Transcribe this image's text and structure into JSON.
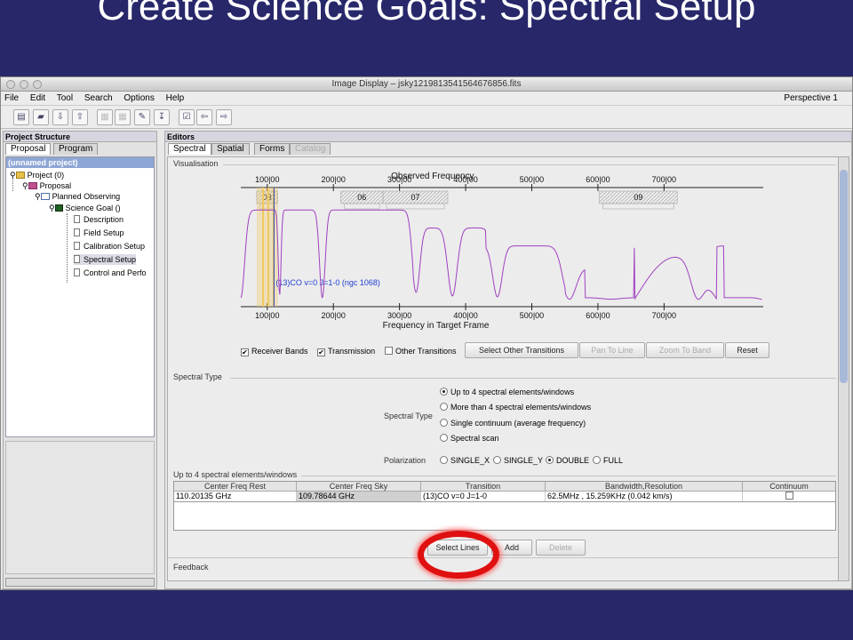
{
  "slide": {
    "title": "Create Science Goals: Spectral Setup"
  },
  "window": {
    "title": "Image Display – jsky1219813541564676856.fits",
    "menu": [
      "File",
      "Edit",
      "Tool",
      "Search",
      "Options",
      "Help"
    ],
    "perspective": "Perspective 1",
    "toolbar_icons": [
      "new-document-icon",
      "open-icon",
      "save-icon",
      "export-icon",
      "cut-icon",
      "copy-icon",
      "validate-icon",
      "import-icon",
      "checkbox-icon",
      "back-arrow-icon",
      "forward-arrow-icon"
    ]
  },
  "project_structure": {
    "header": "Project Structure",
    "tabs": [
      "Proposal",
      "Program"
    ],
    "selected_project": "(unnamed project)",
    "tree": [
      {
        "label": "Project (0)"
      },
      {
        "label": "Proposal"
      },
      {
        "label": "Planned Observing"
      },
      {
        "label": "Science Goal ()"
      },
      {
        "label": "Description"
      },
      {
        "label": "Field Setup"
      },
      {
        "label": "Calibration Setup"
      },
      {
        "label": "Spectral Setup"
      },
      {
        "label": "Control and Perfo"
      }
    ]
  },
  "editors": {
    "header": "Editors",
    "tabs": [
      "Spectral",
      "Spatial",
      "Forms",
      "Catalog"
    ],
    "visualisation": {
      "label": "Visualisation",
      "checks": [
        {
          "label": "Receiver Bands",
          "checked": true
        },
        {
          "label": "Transmission",
          "checked": true
        },
        {
          "label": "Other Transitions",
          "checked": false
        }
      ],
      "buttons": [
        {
          "label": "Select Other Transitions",
          "enabled": true
        },
        {
          "label": "Pan To Line",
          "enabled": false
        },
        {
          "label": "Zoom To Band",
          "enabled": false
        },
        {
          "label": "Reset",
          "enabled": true
        }
      ]
    },
    "spectral_type": {
      "label": "Spectral Type",
      "field_label": "Spectral Type",
      "options": [
        {
          "label": "Up to 4 spectral elements/windows",
          "selected": true
        },
        {
          "label": "More than 4 spectral elements/windows",
          "selected": false
        },
        {
          "label": "Single continuum (average frequency)",
          "selected": false
        },
        {
          "label": "Spectral scan",
          "selected": false
        }
      ],
      "polarization_label": "Polarization",
      "polarization": [
        {
          "label": "SINGLE_X",
          "selected": false
        },
        {
          "label": "SINGLE_Y",
          "selected": false
        },
        {
          "label": "DOUBLE",
          "selected": true
        },
        {
          "label": "FULL",
          "selected": false
        }
      ]
    },
    "windows": {
      "label": "Up to 4 spectral elements/windows",
      "columns": [
        "Center Freq Rest",
        "Center Freq Sky",
        "Transition",
        "Bandwidth,Resolution",
        "Continuum"
      ],
      "rows": [
        [
          "110.20135 GHz",
          "109.78644 GHz",
          "(13)CO v=0 J=1-0",
          "62.5MHz , 15.259KHz (0.042 km/s)",
          ""
        ]
      ],
      "buttons": [
        {
          "label": "Select Lines",
          "enabled": true
        },
        {
          "label": "Add",
          "enabled": true
        },
        {
          "label": "Delete",
          "enabled": false
        }
      ]
    },
    "feedback_label": "Feedback"
  },
  "chart_data": {
    "type": "line",
    "title": "Observed Frequency",
    "xlabel": "Frequency in Target Frame",
    "xlim": [
      60,
      850
    ],
    "ylim": [
      0,
      1
    ],
    "top_ticks": [
      "100|00",
      "200|00",
      "300|00",
      "400|00",
      "500|00",
      "600|00",
      "700|00"
    ],
    "bottom_ticks": [
      "100|00",
      "200|00",
      "300|00",
      "400|00",
      "500|00",
      "600|00",
      "700|00"
    ],
    "tick_values": [
      100,
      200,
      300,
      400,
      500,
      600,
      700
    ],
    "bands": [
      {
        "label": "03",
        "range": [
          84,
          116
        ]
      },
      {
        "label": "06",
        "range": [
          211,
          275
        ]
      },
      {
        "label": "07",
        "range": [
          275,
          373
        ]
      },
      {
        "label": "09",
        "range": [
          602,
          720
        ]
      }
    ],
    "line_annotation": "(13)CO v=0 J=1-0 (ngc 1068)",
    "line_frequency": 110.2,
    "colors": {
      "transmission": "#a040c0",
      "receiver_band": "#f0c860",
      "annotation": "#2040d0"
    }
  }
}
